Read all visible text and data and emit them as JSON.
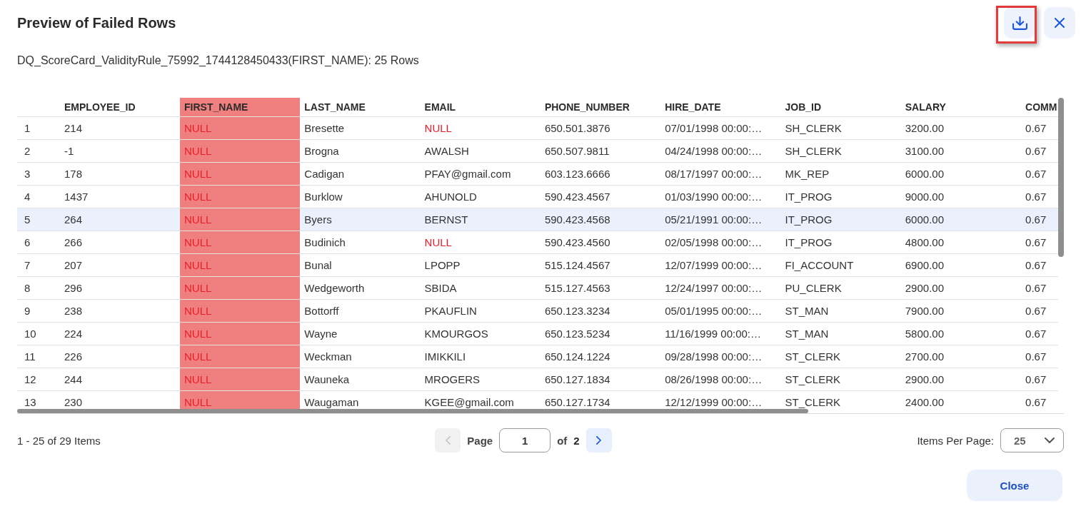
{
  "dialog": {
    "title": "Preview of Failed Rows",
    "subtitle": "DQ_ScoreCard_ValidityRule_75992_1744128450433(FIRST_NAME): 25 Rows"
  },
  "header_buttons": [
    {
      "kind": "download",
      "highlighted": true
    },
    {
      "kind": "close",
      "highlighted": false
    }
  ],
  "table": {
    "columns": [
      {
        "label": "EMPLOYEE_ID",
        "highlighted": false
      },
      {
        "label": "FIRST_NAME",
        "highlighted": true
      },
      {
        "label": "LAST_NAME",
        "highlighted": false
      },
      {
        "label": "EMAIL",
        "highlighted": false
      },
      {
        "label": "PHONE_NUMBER",
        "highlighted": false
      },
      {
        "label": "HIRE_DATE",
        "highlighted": false
      },
      {
        "label": "JOB_ID",
        "highlighted": false
      },
      {
        "label": "SALARY",
        "highlighted": false
      },
      {
        "label": "COMM",
        "highlighted": false
      }
    ],
    "rows": [
      {
        "number": "1",
        "selected": false,
        "cells": [
          {
            "text": "214",
            "null": false
          },
          {
            "text": "NULL",
            "null": true
          },
          {
            "text": "Bresette",
            "null": false
          },
          {
            "text": "NULL",
            "null": true
          },
          {
            "text": "650.501.3876",
            "null": false
          },
          {
            "text": "07/01/1998 00:00:…",
            "null": false
          },
          {
            "text": "SH_CLERK",
            "null": false
          },
          {
            "text": "3200.00",
            "null": false
          },
          {
            "text": "0.67",
            "null": false
          }
        ]
      },
      {
        "number": "2",
        "selected": false,
        "cells": [
          {
            "text": "-1",
            "null": false
          },
          {
            "text": "NULL",
            "null": true
          },
          {
            "text": "Brogna",
            "null": false
          },
          {
            "text": "AWALSH",
            "null": false
          },
          {
            "text": "650.507.9811",
            "null": false
          },
          {
            "text": "04/24/1998 00:00:…",
            "null": false
          },
          {
            "text": "SH_CLERK",
            "null": false
          },
          {
            "text": "3100.00",
            "null": false
          },
          {
            "text": "0.67",
            "null": false
          }
        ]
      },
      {
        "number": "3",
        "selected": false,
        "cells": [
          {
            "text": "178",
            "null": false
          },
          {
            "text": "NULL",
            "null": true
          },
          {
            "text": "Cadigan",
            "null": false
          },
          {
            "text": "PFAY@gmail.com",
            "null": false
          },
          {
            "text": "603.123.6666",
            "null": false
          },
          {
            "text": "08/17/1997 00:00:…",
            "null": false
          },
          {
            "text": "MK_REP",
            "null": false
          },
          {
            "text": "6000.00",
            "null": false
          },
          {
            "text": "0.67",
            "null": false
          }
        ]
      },
      {
        "number": "4",
        "selected": false,
        "cells": [
          {
            "text": "1437",
            "null": false
          },
          {
            "text": "NULL",
            "null": true
          },
          {
            "text": "Burklow",
            "null": false
          },
          {
            "text": "AHUNOLD",
            "null": false
          },
          {
            "text": "590.423.4567",
            "null": false
          },
          {
            "text": "01/03/1990 00:00:…",
            "null": false
          },
          {
            "text": "IT_PROG",
            "null": false
          },
          {
            "text": "9000.00",
            "null": false
          },
          {
            "text": "0.67",
            "null": false
          }
        ]
      },
      {
        "number": "5",
        "selected": true,
        "cells": [
          {
            "text": "264",
            "null": false
          },
          {
            "text": "NULL",
            "null": true
          },
          {
            "text": "Byers",
            "null": false
          },
          {
            "text": "BERNST",
            "null": false
          },
          {
            "text": "590.423.4568",
            "null": false
          },
          {
            "text": "05/21/1991 00:00:…",
            "null": false
          },
          {
            "text": "IT_PROG",
            "null": false
          },
          {
            "text": "6000.00",
            "null": false
          },
          {
            "text": "0.67",
            "null": false
          }
        ]
      },
      {
        "number": "6",
        "selected": false,
        "cells": [
          {
            "text": "266",
            "null": false
          },
          {
            "text": "NULL",
            "null": true
          },
          {
            "text": "Budinich",
            "null": false
          },
          {
            "text": "NULL",
            "null": true
          },
          {
            "text": "590.423.4560",
            "null": false
          },
          {
            "text": "02/05/1998 00:00:…",
            "null": false
          },
          {
            "text": "IT_PROG",
            "null": false
          },
          {
            "text": "4800.00",
            "null": false
          },
          {
            "text": "0.67",
            "null": false
          }
        ]
      },
      {
        "number": "7",
        "selected": false,
        "cells": [
          {
            "text": "207",
            "null": false
          },
          {
            "text": "NULL",
            "null": true
          },
          {
            "text": "Bunal",
            "null": false
          },
          {
            "text": "LPOPP",
            "null": false
          },
          {
            "text": "515.124.4567",
            "null": false
          },
          {
            "text": "12/07/1999 00:00:…",
            "null": false
          },
          {
            "text": "FI_ACCOUNT",
            "null": false
          },
          {
            "text": "6900.00",
            "null": false
          },
          {
            "text": "0.67",
            "null": false
          }
        ]
      },
      {
        "number": "8",
        "selected": false,
        "cells": [
          {
            "text": "296",
            "null": false
          },
          {
            "text": "NULL",
            "null": true
          },
          {
            "text": "Wedgeworth",
            "null": false
          },
          {
            "text": "SBIDA",
            "null": false
          },
          {
            "text": "515.127.4563",
            "null": false
          },
          {
            "text": "12/24/1997 00:00:…",
            "null": false
          },
          {
            "text": "PU_CLERK",
            "null": false
          },
          {
            "text": "2900.00",
            "null": false
          },
          {
            "text": "0.67",
            "null": false
          }
        ]
      },
      {
        "number": "9",
        "selected": false,
        "cells": [
          {
            "text": "238",
            "null": false
          },
          {
            "text": "NULL",
            "null": true
          },
          {
            "text": "Bottorff",
            "null": false
          },
          {
            "text": "PKAUFLIN",
            "null": false
          },
          {
            "text": "650.123.3234",
            "null": false
          },
          {
            "text": "05/01/1995 00:00:…",
            "null": false
          },
          {
            "text": "ST_MAN",
            "null": false
          },
          {
            "text": "7900.00",
            "null": false
          },
          {
            "text": "0.67",
            "null": false
          }
        ]
      },
      {
        "number": "10",
        "selected": false,
        "cells": [
          {
            "text": "224",
            "null": false
          },
          {
            "text": "NULL",
            "null": true
          },
          {
            "text": "Wayne",
            "null": false
          },
          {
            "text": "KMOURGOS",
            "null": false
          },
          {
            "text": "650.123.5234",
            "null": false
          },
          {
            "text": "11/16/1999 00:00:…",
            "null": false
          },
          {
            "text": "ST_MAN",
            "null": false
          },
          {
            "text": "5800.00",
            "null": false
          },
          {
            "text": "0.67",
            "null": false
          }
        ]
      },
      {
        "number": "11",
        "selected": false,
        "cells": [
          {
            "text": "226",
            "null": false
          },
          {
            "text": "NULL",
            "null": true
          },
          {
            "text": "Weckman",
            "null": false
          },
          {
            "text": "IMIKKILI",
            "null": false
          },
          {
            "text": "650.124.1224",
            "null": false
          },
          {
            "text": "09/28/1998 00:00:…",
            "null": false
          },
          {
            "text": "ST_CLERK",
            "null": false
          },
          {
            "text": "2700.00",
            "null": false
          },
          {
            "text": "0.67",
            "null": false
          }
        ]
      },
      {
        "number": "12",
        "selected": false,
        "cells": [
          {
            "text": "244",
            "null": false
          },
          {
            "text": "NULL",
            "null": true
          },
          {
            "text": "Wauneka",
            "null": false
          },
          {
            "text": "MROGERS",
            "null": false
          },
          {
            "text": "650.127.1834",
            "null": false
          },
          {
            "text": "08/26/1998 00:00:…",
            "null": false
          },
          {
            "text": "ST_CLERK",
            "null": false
          },
          {
            "text": "2900.00",
            "null": false
          },
          {
            "text": "0.67",
            "null": false
          }
        ]
      },
      {
        "number": "13",
        "selected": false,
        "cells": [
          {
            "text": "230",
            "null": false
          },
          {
            "text": "NULL",
            "null": true
          },
          {
            "text": "Waugaman",
            "null": false
          },
          {
            "text": "KGEE@gmail.com",
            "null": false
          },
          {
            "text": "650.127.1734",
            "null": false
          },
          {
            "text": "12/12/1999 00:00:…",
            "null": false
          },
          {
            "text": "ST_CLERK",
            "null": false
          },
          {
            "text": "2400.00",
            "null": false
          },
          {
            "text": "0.67",
            "null": false
          }
        ]
      }
    ]
  },
  "pagination": {
    "summary": "1 - 25 of 29 Items",
    "prev_button": {
      "disabled": true
    },
    "page_label": "Page",
    "page": "1",
    "of_label": "of",
    "total_pages": "2",
    "next_button": {
      "disabled": false
    },
    "per_page_label": "Items Per Page:",
    "per_page": "25"
  },
  "footer": {
    "close_button": "Close"
  }
}
